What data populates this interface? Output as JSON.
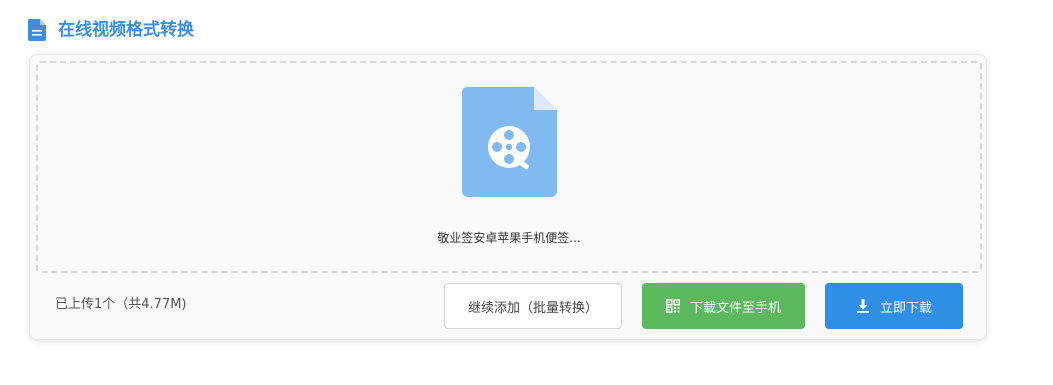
{
  "header": {
    "title": "在线视频格式转换",
    "icon": "document-icon",
    "accent_color": "#3a8ee6"
  },
  "upload": {
    "file_icon": "video-file-icon",
    "file_name": "敬业签安卓苹果手机便签...",
    "status": "已上传1个（共4.77M)"
  },
  "actions": {
    "continue_label": "继续添加（批量转换）",
    "phone_label": "下载文件至手机",
    "phone_icon": "qr-code-icon",
    "phone_color": "#5cb85c",
    "download_label": "立即下载",
    "download_icon": "download-icon",
    "download_color": "#2f8fe5"
  }
}
